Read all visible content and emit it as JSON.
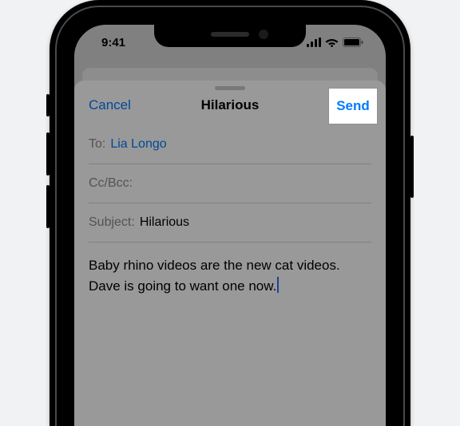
{
  "status": {
    "time": "9:41"
  },
  "sheet": {
    "cancel_label": "Cancel",
    "send_label": "Send",
    "title": "Hilarious",
    "to_label": "To:",
    "to_value": "Lia Longo",
    "cc_label": "Cc/Bcc:",
    "cc_value": "",
    "subject_label": "Subject:",
    "subject_value": "Hilarious",
    "body": "Baby rhino videos are the new cat videos. Dave is going to want one now."
  },
  "highlight": {
    "label": "Send"
  }
}
